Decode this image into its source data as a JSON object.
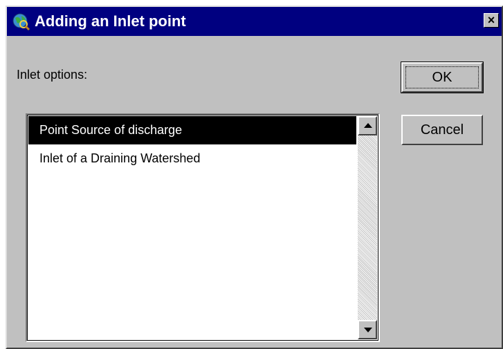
{
  "window": {
    "title": "Adding an Inlet point",
    "close_label": "×"
  },
  "dialog": {
    "label": "Inlet options:",
    "options": [
      {
        "label": "Point Source of discharge",
        "selected": true
      },
      {
        "label": "Inlet of a Draining Watershed",
        "selected": false
      }
    ]
  },
  "buttons": {
    "ok_label": "OK",
    "cancel_label": "Cancel"
  },
  "icons": {
    "app": "globe-icon",
    "close": "close-icon",
    "scroll_up": "arrow-up-icon",
    "scroll_down": "arrow-down-icon"
  },
  "colors": {
    "titlebar": "#000080",
    "face": "#c0c0c0",
    "selection": "#000000"
  }
}
